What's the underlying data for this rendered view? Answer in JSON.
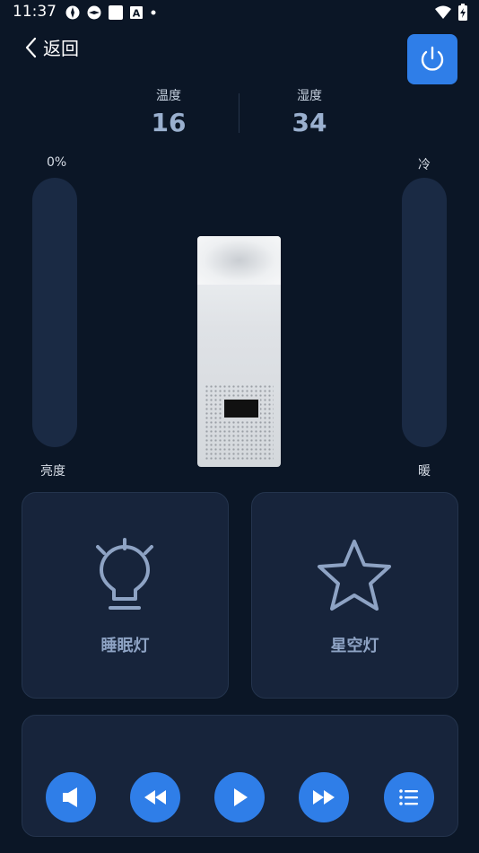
{
  "status_bar": {
    "time": "11:37",
    "icons": [
      "app-icon",
      "app-icon",
      "square-icon",
      "a-icon",
      "dot-icon"
    ],
    "right_icons": [
      "wifi-icon",
      "battery-charging-icon"
    ]
  },
  "header": {
    "back_label": "返回"
  },
  "metrics": {
    "temperature_label": "温度",
    "temperature_value": "16",
    "humidity_label": "湿度",
    "humidity_value": "34"
  },
  "sliders": {
    "brightness_percent_label": "0%",
    "brightness_label": "亮度",
    "brightness_value": 0,
    "color_top_label": "冷",
    "color_bottom_label": "暖"
  },
  "cards": {
    "sleep_light_label": "睡眠灯",
    "star_light_label": "星空灯"
  },
  "media": {
    "buttons": [
      "speaker-icon",
      "rewind-icon",
      "play-icon",
      "fast-forward-icon",
      "list-icon"
    ]
  },
  "colors": {
    "background": "#0b1626",
    "accent": "#2f7ee8",
    "card": "#17243b",
    "muted_text": "#8ea3c4"
  }
}
